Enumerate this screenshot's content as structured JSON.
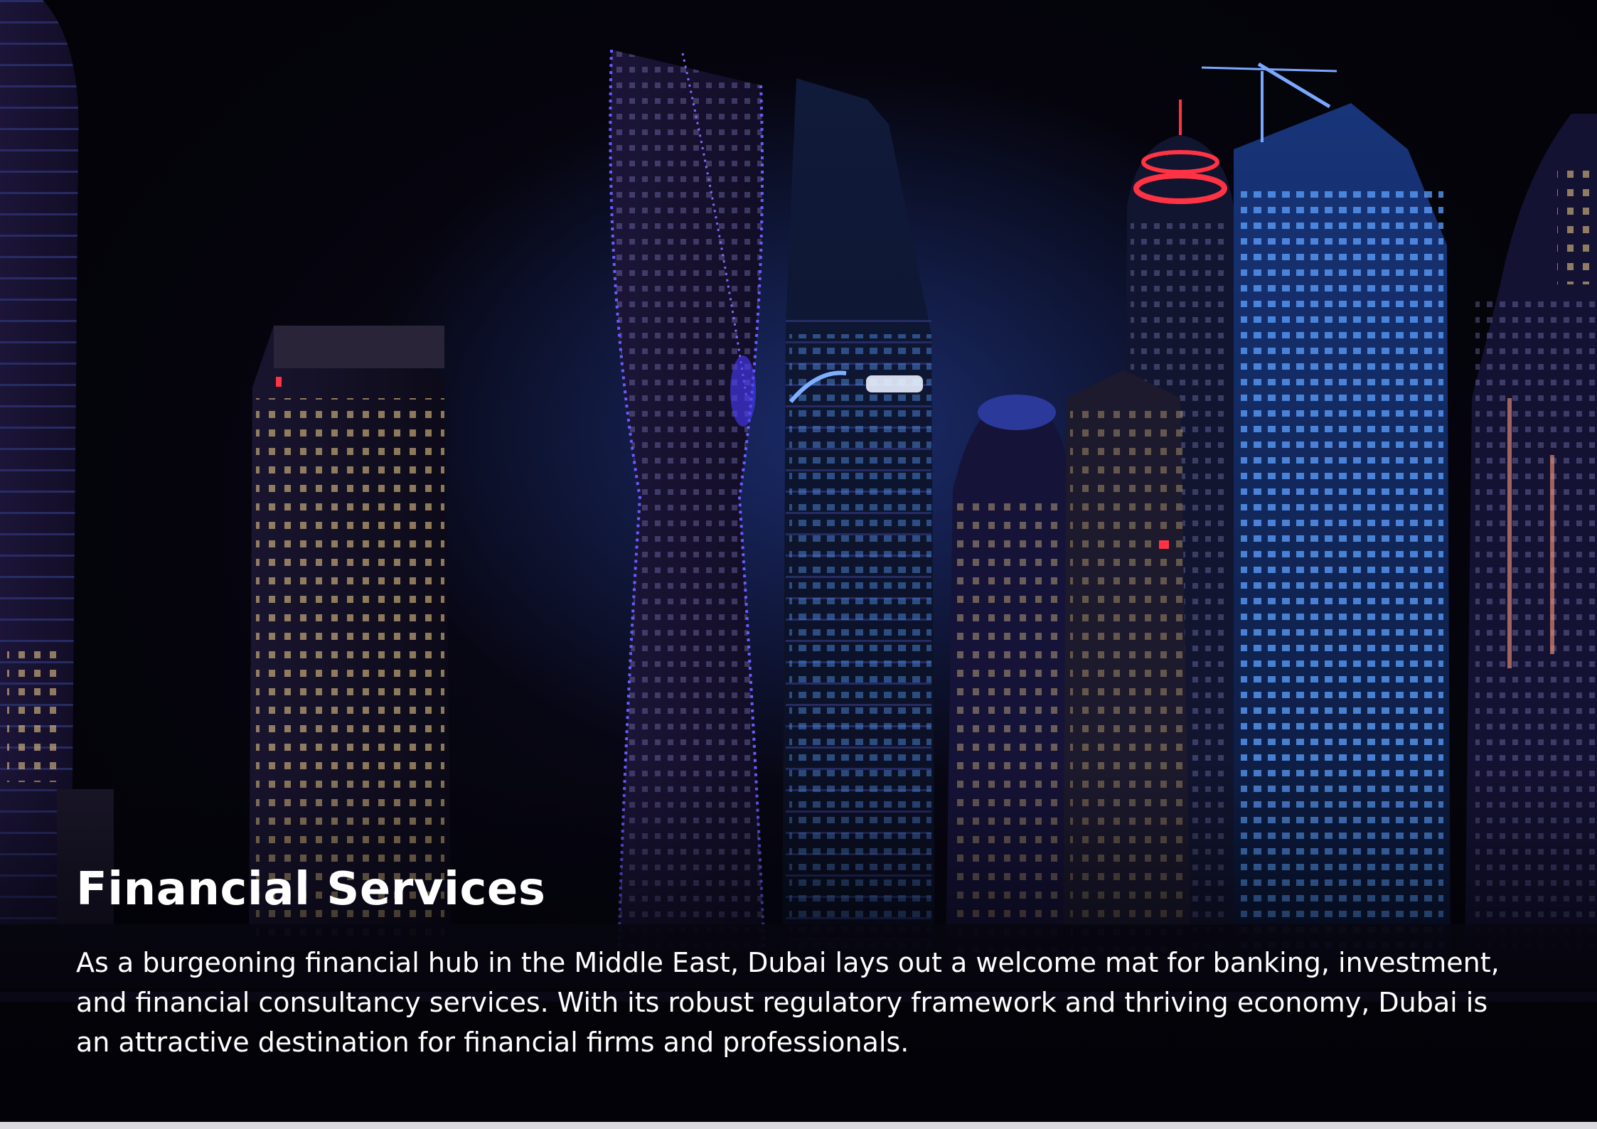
{
  "content": {
    "title": "Financial Services",
    "description": "As a burgeoning financial hub in the Middle East, Dubai lays out a welcome mat for banking, investment, and financial consultancy services. With its robust regulatory framework and thriving economy, Dubai is an attractive destination for financial firms and professionals."
  },
  "background": {
    "subject": "night-skyline-illustration"
  },
  "colors": {
    "text": "#ffffff",
    "sky": "#04030a",
    "accent_blue": "#4a7dff",
    "accent_red": "#ff3344",
    "window_warm": "#f3d28a"
  }
}
